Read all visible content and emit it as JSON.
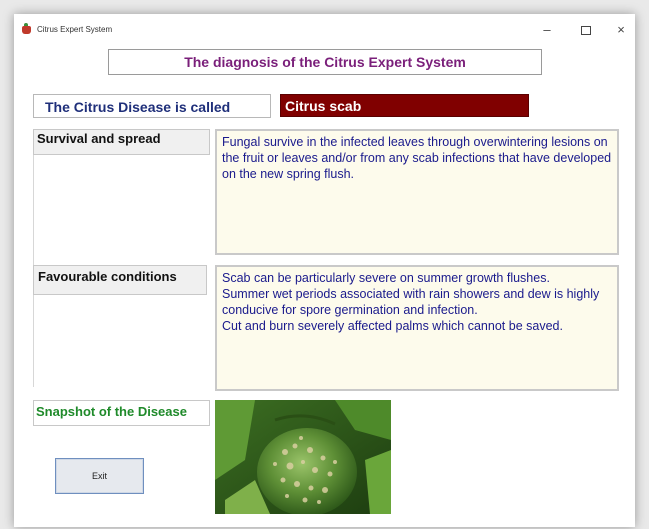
{
  "window": {
    "title": "Citrus Expert System",
    "controls": {
      "minimize": "–",
      "close": "×"
    }
  },
  "heading": "The diagnosis of the Citrus Expert System",
  "disease": {
    "label": "The Citrus Disease is called",
    "value": "Citrus scab"
  },
  "survival": {
    "label": "Survival and spread",
    "text": "Fungal survive in the infected leaves through overwintering lesions on the fruit or leaves and/or from any scab infections that have developed on the new spring flush."
  },
  "conditions": {
    "label": "Favourable conditions",
    "lines": [
      "Scab can be particularly severe on summer growth flushes.",
      "Summer wet periods associated with rain showers and dew is highly conducive for spore germination and infection.",
      "Cut and burn severely affected palms which cannot be saved."
    ]
  },
  "snapshot": {
    "label": "Snapshot of the Disease"
  },
  "exit_label": "Exit",
  "colors": {
    "heading": "#7a1f7a",
    "disease_label": "#1f2f7a",
    "disease_value_bg": "#800000",
    "text": "#1a1a8c",
    "textarea_bg": "#fdfbec",
    "snapshot_label": "#1f8a2a"
  },
  "icons": [
    "app-icon",
    "minimize-icon",
    "maximize-icon",
    "close-icon"
  ]
}
